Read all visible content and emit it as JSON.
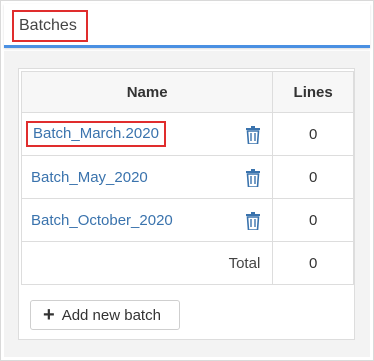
{
  "header": {
    "title": "Batches"
  },
  "table": {
    "columns": [
      "Name",
      "Lines"
    ],
    "rows": [
      {
        "name": "Batch_March.2020",
        "lines": "0"
      },
      {
        "name": "Batch_May_2020",
        "lines": "0"
      },
      {
        "name": "Batch_October_2020",
        "lines": "0"
      }
    ],
    "total_label": "Total",
    "total_value": "0"
  },
  "actions": {
    "add_label": "Add new batch",
    "add_icon": "plus-icon"
  },
  "icons": {
    "delete": "trash-icon"
  },
  "colors": {
    "link": "#3a73ad",
    "accent": "#4a90e2",
    "highlight": "#e02d2d"
  }
}
